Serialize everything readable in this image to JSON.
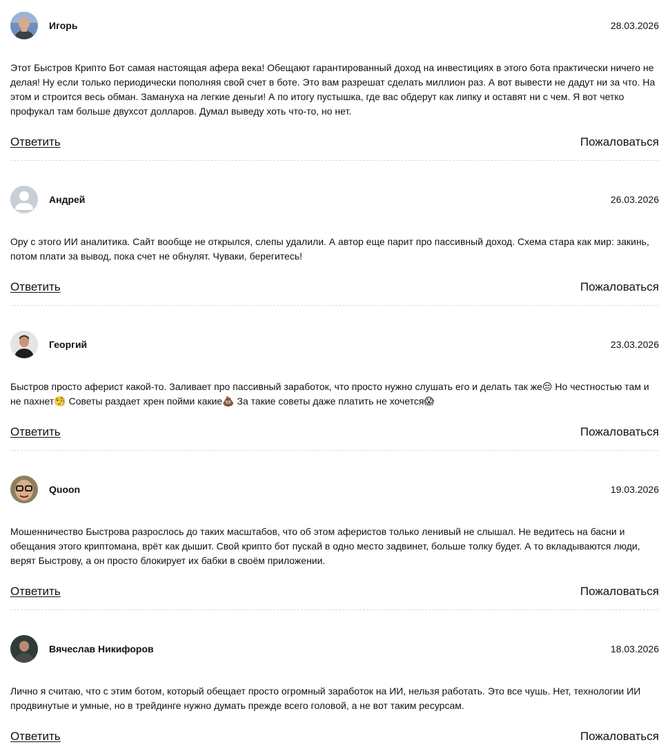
{
  "actions": {
    "reply_label": "Ответить",
    "report_label": "Пожаловаться"
  },
  "comments": [
    {
      "author": "Игорь",
      "date": "28.03.2026",
      "avatar": "photo-man-bald",
      "text": "Этот Быстров Крипто Бот самая настоящая афера века! Обещают гарантированный доход на инвестициях в этого бота практически ничего не делая! Ну если только периодически пополняя свой счет в боте. Это вам разрешат сделать миллион раз. А вот вывести не дадут ни за что. На этом и строится весь обман. Замануха на легкие деньги! А по итогу пустышка, где вас обдерут как липку и оставят ни с чем. Я вот четко профукал там больше двухсот долларов. Думал выведу хоть что-то, но нет."
    },
    {
      "author": "Андрей",
      "date": "26.03.2026",
      "avatar": "default-user-icon",
      "text": "Ору с этого ИИ аналитика. Сайт вообще не открылся, слепы удалили. А автор еще парит про пассивный доход. Схема стара как мир: закинь, потом плати за вывод, пока счет не обнулят. Чуваки, берегитесь!"
    },
    {
      "author": "Георгий",
      "date": "23.03.2026",
      "avatar": "photo-man-dark",
      "text_parts": [
        "Быстров просто аферист какой-то. Заливает про пассивный заработок, что просто нужно слушать его и делать так же",
        "😔",
        " Но честностью там и не пахнет",
        "🧐",
        " Советы раздает хрен пойми какие",
        "💩",
        " За такие советы даже платить не хочется",
        "😱"
      ]
    },
    {
      "author": "Quoon",
      "date": "19.03.2026",
      "avatar": "photo-man-glasses",
      "text": "Мошенничество Быстрова разрослось до таких масштабов, что об этом аферистов только ленивый не слышал. Не ведитесь на басни и обещания этого криптомана, врёт как дышит. Свой крипто бот пускай в одно место задвинет, больше толку будет. А то вкладываются люди, верят Быстрову, а он просто блокирует их бабки в своём приложении."
    },
    {
      "author": "Вячеслав Никифоров",
      "date": "18.03.2026",
      "avatar": "photo-man-tshirt",
      "text": "Лично я считаю, что с этим ботом, который обещает просто огромный заработок на ИИ, нельзя работать. Это все чушь. Нет, технологии ИИ продвинутые и умные, но в трейдинге нужно думать прежде всего головой, а не вот таким ресурсам."
    }
  ]
}
